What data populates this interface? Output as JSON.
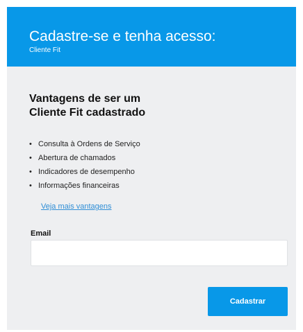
{
  "header": {
    "title": "Cadastre-se e tenha acesso:",
    "subtitle": "Cliente Fit"
  },
  "benefits_section": {
    "heading_line1": "Vantagens de ser um",
    "heading_line2": "Cliente Fit cadastrado",
    "items": [
      "Consulta à Ordens de Serviço",
      "Abertura de chamados",
      "Indicadores de desempenho",
      "Informações financeiras"
    ],
    "more_link": "Veja mais vantagens"
  },
  "form": {
    "email_label": "Email",
    "email_value": "",
    "submit_label": "Cadastrar"
  },
  "colors": {
    "accent": "#0898e8",
    "panel_background": "#eeeff1",
    "link": "#2f8ed6"
  }
}
